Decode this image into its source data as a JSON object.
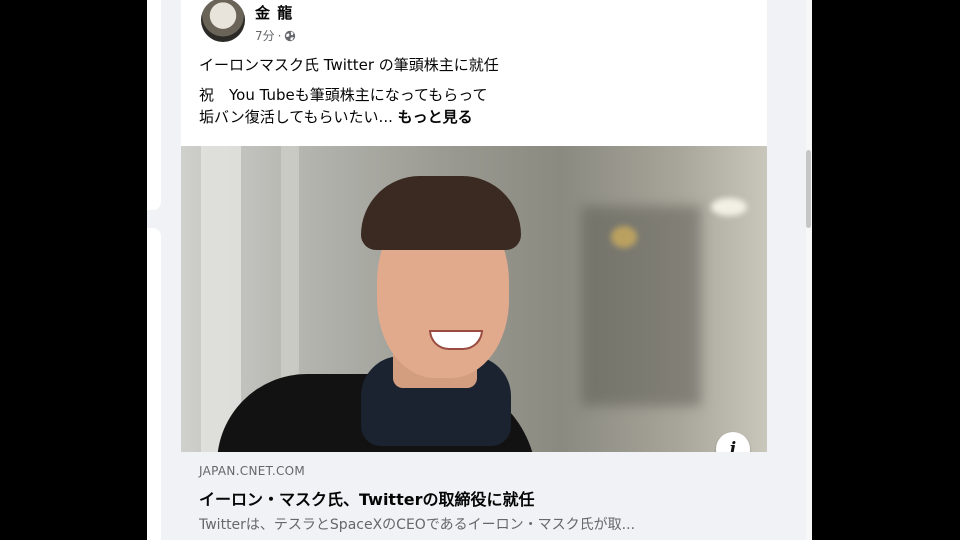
{
  "post": {
    "author": "金 龍",
    "time": "7分",
    "separator": "·",
    "visibility_icon": "globe-icon",
    "headline": "イーロンマスク氏 Twitter の筆頭株主に就任",
    "body_line1": "祝　You Tubeも筆頭株主になってもらって",
    "body_line2": "垢バン復活してもらいたい...",
    "see_more": "もっと見る"
  },
  "link_preview": {
    "domain": "JAPAN.CNET.COM",
    "title": "イーロン・マスク氏、Twitterの取締役に就任",
    "description": "Twitterは、テスラとSpaceXのCEOであるイーロン・マスク氏が取...",
    "info_icon": "info-icon",
    "info_label": "i"
  },
  "colors": {
    "background": "#f0f2f5",
    "card": "#ffffff",
    "secondary_text": "#65676b",
    "primary_text": "#050505"
  }
}
